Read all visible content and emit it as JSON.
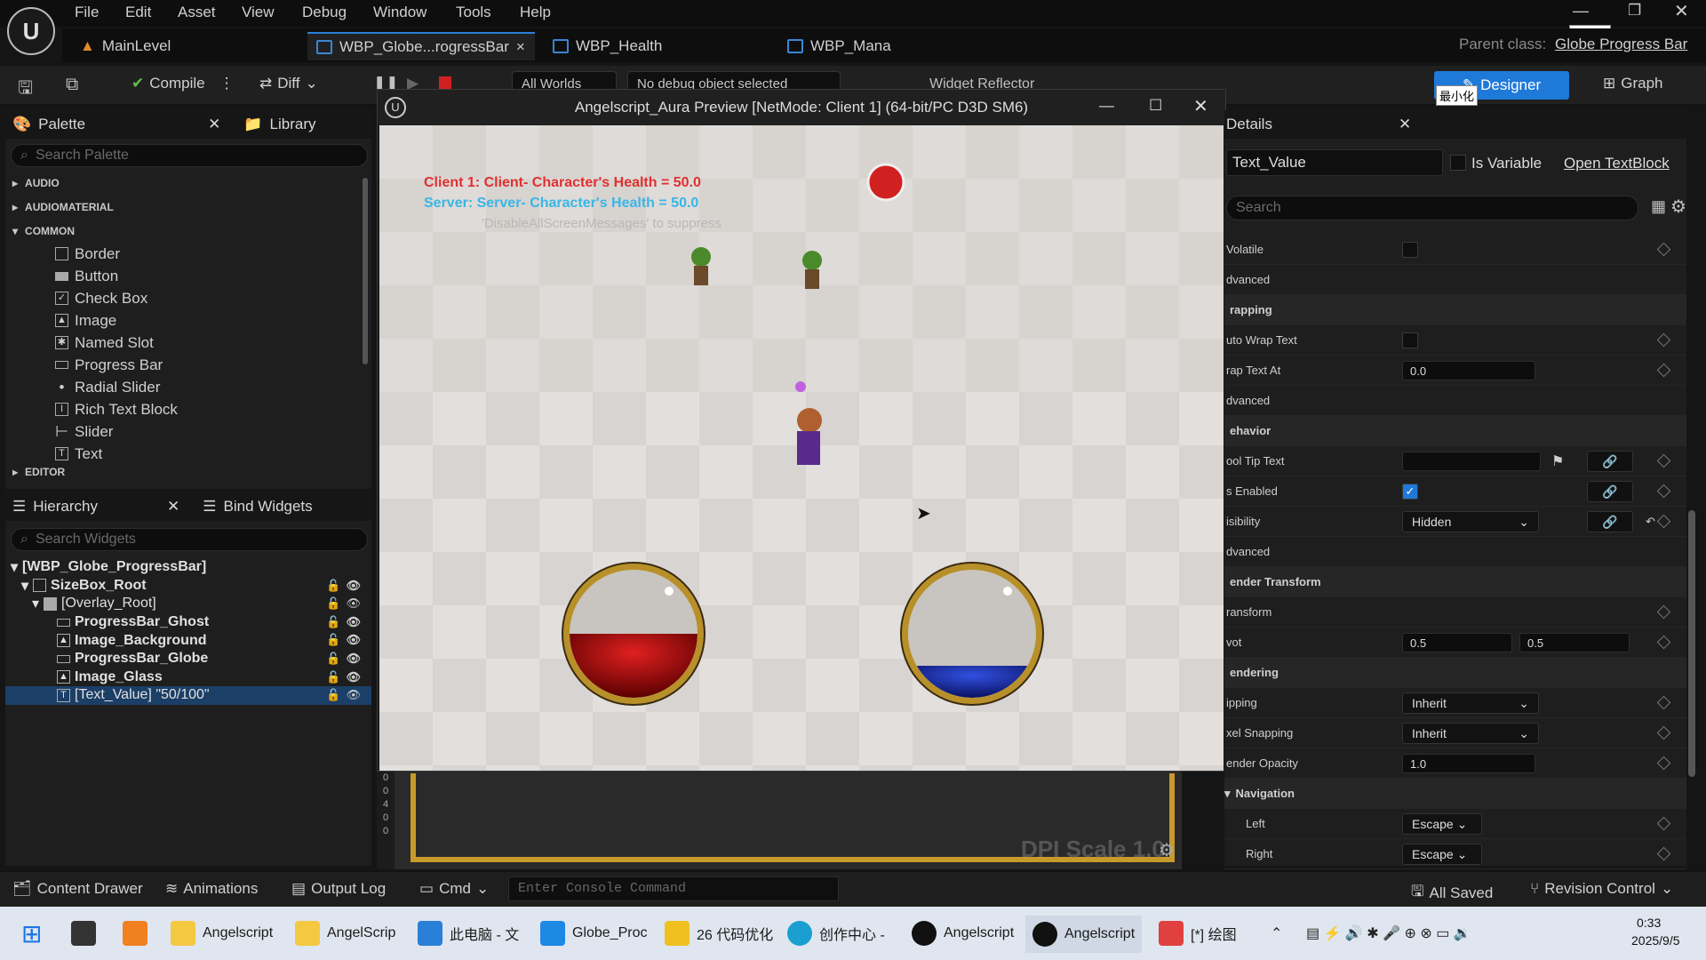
{
  "menu": [
    "File",
    "Edit",
    "Asset",
    "View",
    "Debug",
    "Window",
    "Tools",
    "Help"
  ],
  "tabs": [
    {
      "label": "MainLevel"
    },
    {
      "label": "WBP_Globe...rogressBar",
      "close": "×"
    },
    {
      "label": "WBP_Health"
    },
    {
      "label": "WBP_Mana"
    }
  ],
  "parent_class": {
    "label": "Parent class:",
    "value": "Globe Progress Bar"
  },
  "ime_tooltip": "最小化",
  "toolbar": {
    "compile": "Compile",
    "diff": "Diff",
    "all_worlds": "All Worlds",
    "debug_object": "No debug object selected",
    "widget_reflector": "Widget Reflector",
    "designer": "Designer",
    "graph": "Graph"
  },
  "palette": {
    "title": "Palette",
    "library": "Library",
    "search_placeholder": "Search Palette",
    "categories": [
      "AUDIO",
      "AUDIOMATERIAL",
      "COMMON",
      "EDITOR"
    ],
    "items": [
      "Border",
      "Button",
      "Check Box",
      "Image",
      "Named Slot",
      "Progress Bar",
      "Radial Slider",
      "Rich Text Block",
      "Slider",
      "Text"
    ]
  },
  "hierarchy": {
    "title": "Hierarchy",
    "bind": "Bind Widgets",
    "search_placeholder": "Search Widgets",
    "rows": [
      "[WBP_Globe_ProgressBar]",
      "SizeBox_Root",
      "[Overlay_Root]",
      "ProgressBar_Ghost",
      "Image_Background",
      "ProgressBar_Globe",
      "Image_Glass",
      "[Text_Value] \"50/100\""
    ]
  },
  "preview": {
    "title": "Angelscript_Aura Preview [NetMode: Client 1]  (64-bit/PC D3D SM6)",
    "msg1": "Client 1: Client- Character's Health = 50.0",
    "msg2": "Server: Server- Character's Health = 50.0",
    "msg3": "'DisableAllScreenMessages' to suppress",
    "health_fill": 0.5,
    "mana_fill": 0.25,
    "colors": {
      "client_msg": "#e03030",
      "server_msg": "#38b6e8",
      "health": "#b01010",
      "mana": "#1030b0"
    }
  },
  "designer_canvas": {
    "dpi": "DPI Scale 1.0",
    "ruler": [
      "0",
      "0",
      "4",
      "0",
      "0"
    ]
  },
  "details": {
    "title": "Details",
    "name": "Text_Value",
    "is_variable": "Is Variable",
    "open": "Open TextBlock",
    "search_placeholder": "Search",
    "rows": [
      {
        "label": "Volatile",
        "type": "check",
        "checked": false
      },
      {
        "label": "dvanced",
        "type": "plain"
      },
      {
        "label": "rapping",
        "type": "section"
      },
      {
        "label": "uto Wrap Text",
        "type": "check",
        "checked": false
      },
      {
        "label": "rap Text At",
        "type": "value",
        "value": "0.0"
      },
      {
        "label": "dvanced",
        "type": "plain"
      },
      {
        "label": "ehavior",
        "type": "section"
      },
      {
        "label": "ool Tip Text",
        "type": "tooltip"
      },
      {
        "label": "s Enabled",
        "type": "check",
        "checked": true
      },
      {
        "label": "isibility",
        "type": "dropdown",
        "value": "Hidden"
      },
      {
        "label": "dvanced",
        "type": "plain"
      },
      {
        "label": "ender Transform",
        "type": "section"
      },
      {
        "label": "ransform",
        "type": "plain"
      },
      {
        "label": "vot",
        "type": "pair",
        "a": "0.5",
        "b": "0.5"
      },
      {
        "label": "endering",
        "type": "section"
      },
      {
        "label": "ipping",
        "type": "dropdown",
        "value": "Inherit"
      },
      {
        "label": "xel Snapping",
        "type": "dropdown",
        "value": "Inherit"
      },
      {
        "label": "ender Opacity",
        "type": "value",
        "value": "1.0"
      },
      {
        "label": "Navigation",
        "type": "section"
      },
      {
        "label": "Left",
        "type": "escape",
        "value": "Escape"
      },
      {
        "label": "Right",
        "type": "escape",
        "value": "Escape"
      }
    ]
  },
  "bottom": {
    "content_drawer": "Content Drawer",
    "animations": "Animations",
    "output_log": "Output Log",
    "cmd": "Cmd",
    "console_placeholder": "Enter Console Command",
    "all_saved": "All Saved",
    "revision": "Revision Control"
  },
  "taskbar": {
    "apps": [
      "Angelscript",
      "AngelScrip",
      "此电脑 - 文",
      "Globe_Proc",
      "26 代码优化",
      "创作中心 -",
      "Angelscript",
      "Angelscript",
      "[*] 绘图"
    ],
    "time": "0:33",
    "date": "2025/9/5"
  }
}
